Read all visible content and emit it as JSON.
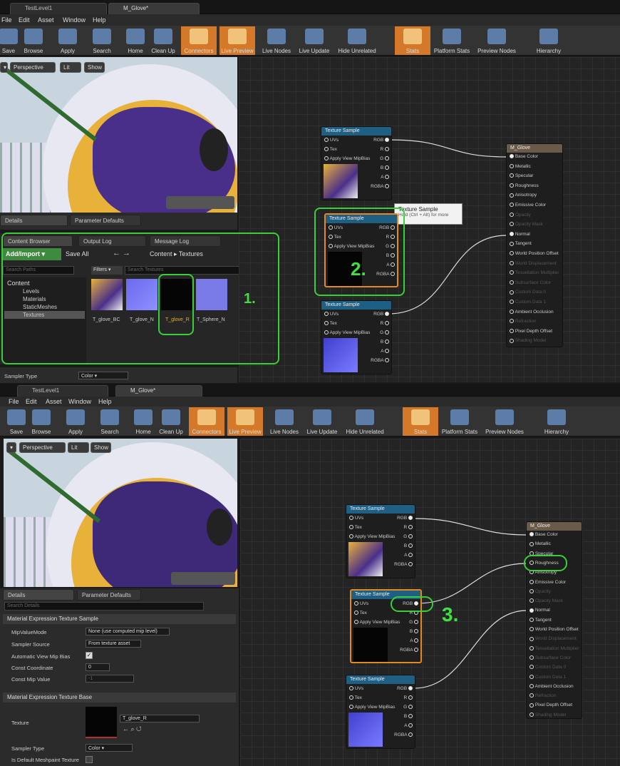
{
  "top": {
    "tabs": [
      "TestLevel1",
      "M_Glove*"
    ],
    "menu": [
      "File",
      "Edit",
      "Asset",
      "Window",
      "Help"
    ],
    "toolbar": [
      "Save",
      "Browse",
      "Apply",
      "Search",
      "Home",
      "Clean Up",
      "Connectors",
      "Live Preview",
      "Live Nodes",
      "Live Update",
      "Hide Unrelated",
      "Stats",
      "Platform Stats",
      "Preview Nodes",
      "Hierarchy"
    ],
    "viewport_buttons": [
      "Perspective",
      "Lit",
      "Show"
    ],
    "panel_tabs": [
      "Details",
      "Parameter Defaults"
    ],
    "content_tabs": [
      "Content Browser",
      "Output Log",
      "Message Log"
    ],
    "add_import": "Add/Import",
    "save_all": "Save All",
    "breadcrumb": [
      "Content",
      "Textures"
    ],
    "search_paths": "Search Paths",
    "filters": "Filters",
    "search_textures": "Search Textures",
    "tree_root": "Content",
    "tree": [
      "Levels",
      "Materials",
      "StaticMeshes",
      "Textures"
    ],
    "assets": [
      "T_glove_BC",
      "T_glove_N",
      "T_glove_R",
      "T_Sphere_N"
    ],
    "sampler_type_label": "Sampler Type",
    "sampler_type_value": "Color",
    "tooltip_title": "Texture Sample",
    "tooltip_hint": "Hold (Ctrl + Alt) for more",
    "annot1": "1.",
    "annot2": "2."
  },
  "nodes": {
    "texture_title": "Texture Sample",
    "inputs": [
      "UVs",
      "Tex",
      "Apply View MipBias"
    ],
    "outputs": [
      "RGB",
      "R",
      "G",
      "B",
      "A",
      "RGBA"
    ],
    "material_title": "M_Glove",
    "material_pins": [
      "Base Color",
      "Metallic",
      "Specular",
      "Roughness",
      "Anisotropy",
      "Emissive Color",
      "Opacity",
      "Opacity Mask",
      "Normal",
      "Tangent",
      "World Position Offset",
      "World Displacement",
      "Tessellation Multiplier",
      "Subsurface Color",
      "Custom Data 0",
      "Custom Data 1",
      "Ambient Occlusion",
      "Refraction",
      "Pixel Depth Offset",
      "Shading Model"
    ]
  },
  "bottom": {
    "details_tabs": [
      "Details",
      "Parameter Defaults"
    ],
    "search_details": "Search Details",
    "section1": "Material Expression Texture Sample",
    "props": [
      {
        "label": "MipValueMode",
        "value": "None (use computed mip level)"
      },
      {
        "label": "Sampler Source",
        "value": "From texture asset"
      },
      {
        "label": "Automatic View Mip Bias",
        "value": ""
      },
      {
        "label": "Const Coordinate",
        "value": "0"
      },
      {
        "label": "Const Mip Value",
        "value": "-1"
      }
    ],
    "section2": "Material Expression Texture Base",
    "texture_label": "Texture",
    "texture_value": "T_glove_R",
    "sampler_type_label": "Sampler Type",
    "sampler_type_value": "Color",
    "meshpaint_label": "Is Default Meshpaint Texture",
    "annot3": "3."
  },
  "colors": {
    "accent": "#d4792a",
    "annotation": "#38d038",
    "node_header": "#1f5f84"
  }
}
